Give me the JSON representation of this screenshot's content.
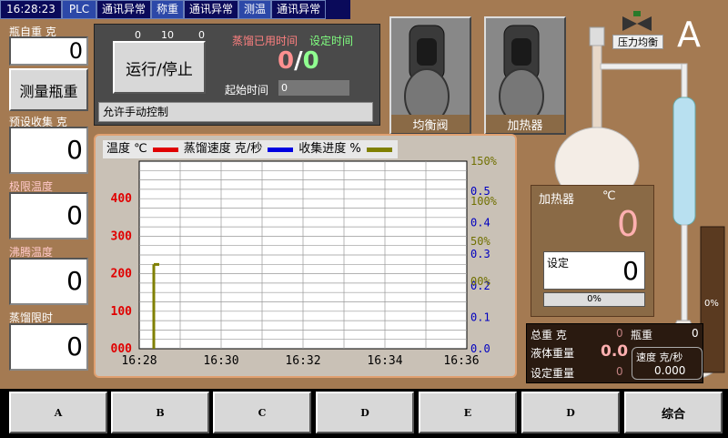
{
  "status_bar": {
    "time": "16:28:23",
    "plc": "PLC",
    "cells": [
      {
        "label": "通讯异常",
        "state": "alarm"
      },
      {
        "label": "称重",
        "state": "ok"
      },
      {
        "label": "通讯异常",
        "state": "alarm"
      },
      {
        "label": "测温",
        "state": "ok"
      },
      {
        "label": "通讯异常",
        "state": "alarm"
      }
    ]
  },
  "left_panel": {
    "bottle_weight_label": "瓶自重 克",
    "bottle_weight_value": "0",
    "measure_button": "测量瓶重",
    "preset_collect_label": "预设收集 克",
    "preset_collect_value": "0",
    "limit_temp_label": "极限温度",
    "limit_temp_value": "0",
    "boil_temp_label": "沸腾温度",
    "boil_temp_value": "0",
    "distill_time_label": "蒸馏限时",
    "distill_time_value": "0"
  },
  "control": {
    "scale_0_left": "0",
    "scale_10": "10",
    "scale_0_right": "0",
    "run_stop_button": "运行/停止",
    "elapsed_label": "蒸馏已用时间",
    "set_time_label": "设定时间",
    "elapsed_value": "0",
    "separator": "/",
    "set_time_value": "0",
    "start_time_label": "起始时间",
    "start_time_value": "0",
    "manual_control": "允许手动控制"
  },
  "chart_data": {
    "type": "line",
    "legend": [
      {
        "name": "温度 ℃",
        "color": "#e00000"
      },
      {
        "name": "蒸馏速度 克/秒",
        "color": "#0000e0"
      },
      {
        "name": "收集进度 %",
        "color": "#808000"
      }
    ],
    "x_ticks": [
      "16:28",
      "16:30",
      "16:32",
      "16:34",
      "16:36"
    ],
    "y_left_ticks": [
      "000",
      "100",
      "200",
      "300",
      "400"
    ],
    "y_right_percent": [
      "00%",
      "50%",
      "100%",
      "150%"
    ],
    "y_right_speed": [
      "0.0",
      "0.1",
      "0.2",
      "0.3",
      "0.4",
      "0.5"
    ],
    "series": [
      {
        "name": "收集进度 %",
        "color": "#808000",
        "points": [
          [
            0,
            0
          ],
          [
            0,
            0.29
          ]
        ]
      }
    ]
  },
  "valves": {
    "equalize_label": "均衡阀",
    "heater_label": "加热器"
  },
  "apparatus": {
    "pressure_balance_label": "压力均衡",
    "mode_letter": "A",
    "receiver_percent": "0%"
  },
  "heater": {
    "label": "加热器",
    "unit": "℃",
    "temp_value": "0",
    "setpoint_label": "设定",
    "setpoint_value": "0",
    "power_percent": "0%"
  },
  "weights": {
    "total_label": "总重 克",
    "total_value": "0",
    "bottle_label": "瓶重",
    "bottle_value": "0",
    "liquid_label": "液体重量",
    "liquid_value": "0.0",
    "set_label": "设定重量",
    "set_value": "0",
    "speed_label": "速度 克/秒",
    "speed_value": "0.000"
  },
  "nav": [
    "A",
    "B",
    "C",
    "D",
    "E",
    "D",
    "综合"
  ],
  "colors": {
    "background": "#a47a52",
    "status_bar": "#0a0a5a",
    "temp_series": "#e00000",
    "speed_series": "#0000e0",
    "progress_series": "#808000"
  }
}
